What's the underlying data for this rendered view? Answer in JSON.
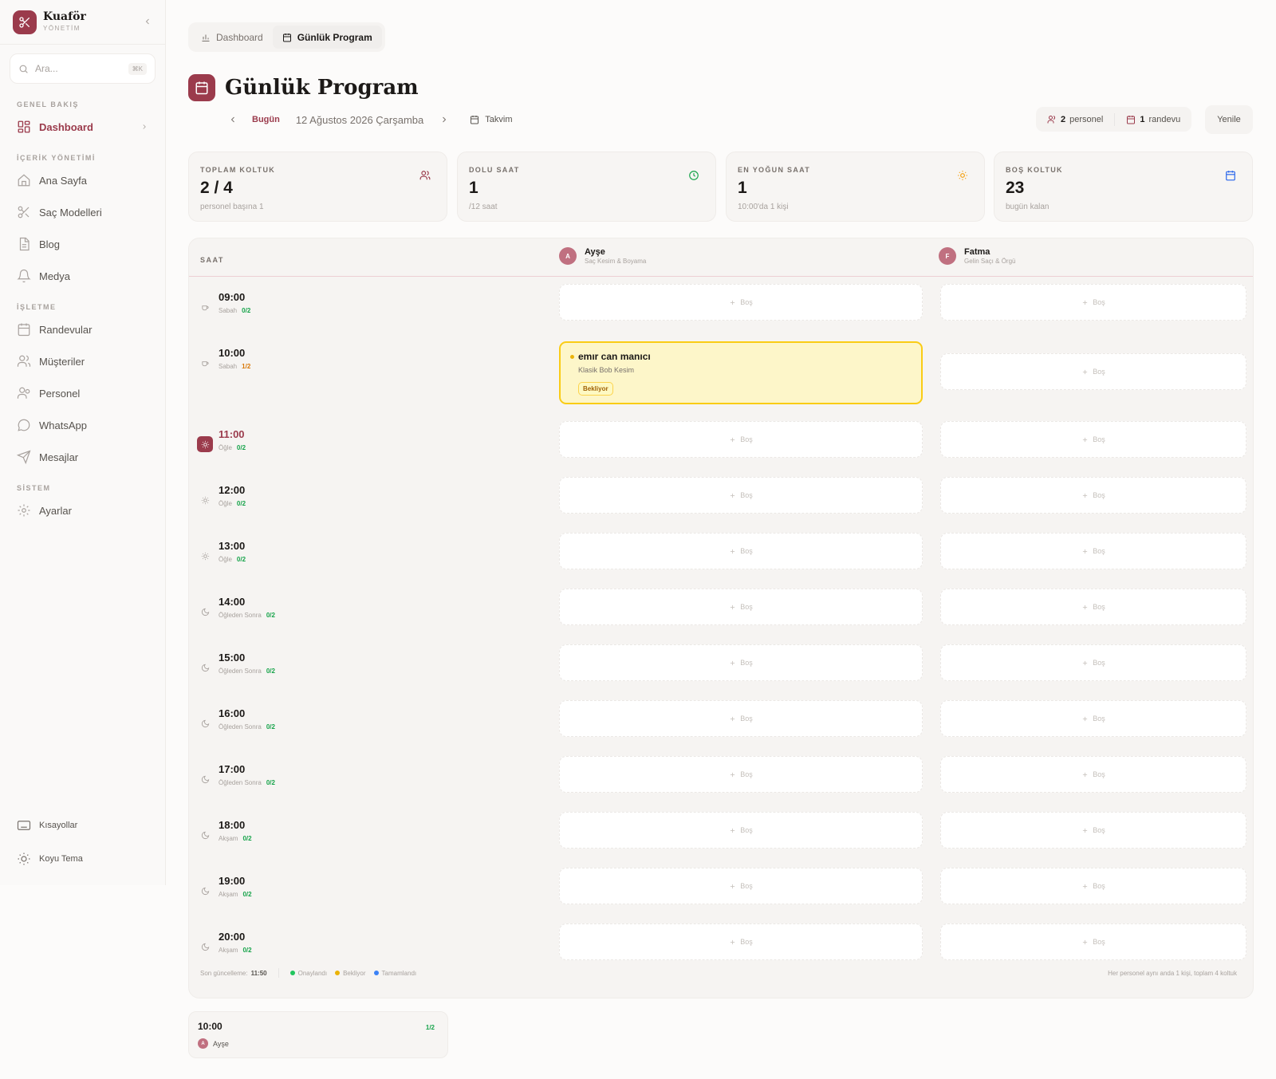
{
  "brand": {
    "name": "Kuaför",
    "subtitle": "YÖNETİM"
  },
  "search": {
    "placeholder": "Ara...",
    "shortcut": "⌘K"
  },
  "sidebar": {
    "groups": [
      {
        "title": "GENEL BAKIŞ",
        "items": [
          {
            "label": "Dashboard",
            "icon": "dashboard-icon",
            "active": true
          }
        ]
      },
      {
        "title": "İÇERİK YÖNETİMİ",
        "items": [
          {
            "label": "Ana Sayfa",
            "icon": "home-icon"
          },
          {
            "label": "Saç Modelleri",
            "icon": "scissors-icon"
          },
          {
            "label": "Blog",
            "icon": "document-icon"
          },
          {
            "label": "Medya",
            "icon": "bell-icon"
          }
        ]
      },
      {
        "title": "İŞLETME",
        "items": [
          {
            "label": "Randevular",
            "icon": "calendar-icon"
          },
          {
            "label": "Müşteriler",
            "icon": "users-icon"
          },
          {
            "label": "Personel",
            "icon": "user-group-icon"
          },
          {
            "label": "WhatsApp",
            "icon": "chat-icon"
          },
          {
            "label": "Mesajlar",
            "icon": "send-icon"
          }
        ]
      },
      {
        "title": "SİSTEM",
        "items": [
          {
            "label": "Ayarlar",
            "icon": "gear-icon"
          }
        ]
      }
    ],
    "bottom": [
      {
        "label": "Kısayollar",
        "icon": "keyboard-icon"
      },
      {
        "label": "Koyu Tema",
        "icon": "sun-icon"
      }
    ]
  },
  "tabs": [
    {
      "label": "Dashboard",
      "icon": "bar-chart-icon",
      "active": false
    },
    {
      "label": "Günlük Program",
      "icon": "calendar-icon",
      "active": true
    }
  ],
  "page": {
    "title": "Günlük Program"
  },
  "date_nav": {
    "today_label": "Bugün",
    "date": "12 Ağustos 2026 Çarşamba",
    "calendar_label": "Takvim"
  },
  "summary": {
    "staff_count": "2",
    "staff_label": "personel",
    "appt_count": "1",
    "appt_label": "randevu",
    "refresh_label": "Yenile"
  },
  "stats": [
    {
      "label": "TOPLAM KOLTUK",
      "value": "2 / 4",
      "sub": "personel başına 1",
      "icon": "users-icon",
      "color": "#9b3b4c"
    },
    {
      "label": "DOLU SAAT",
      "value": "1",
      "sub": "/12 saat",
      "icon": "clock-icon",
      "color": "#16a34a"
    },
    {
      "label": "EN YOĞUN SAAT",
      "value": "1",
      "sub": "10:00'da 1 kişi",
      "icon": "sun-icon",
      "color": "#f59e0b"
    },
    {
      "label": "BOŞ KOLTUK",
      "value": "23",
      "sub": "bugün kalan",
      "icon": "calendar-icon",
      "color": "#2563eb"
    }
  ],
  "schedule": {
    "time_header": "SAAT",
    "empty_label": "Boş",
    "staff": [
      {
        "initial": "A",
        "name": "Ayşe",
        "role": "Saç Kesim & Boyama"
      },
      {
        "initial": "F",
        "name": "Fatma",
        "role": "Gelin Saçı & Örgü"
      }
    ],
    "rows": [
      {
        "time": "09:00",
        "period": "Sabah",
        "occupancy": "0/2",
        "icon": "coffee-icon"
      },
      {
        "time": "10:00",
        "period": "Sabah",
        "occupancy": "1/2",
        "icon": "coffee-icon"
      },
      {
        "time": "11:00",
        "period": "Öğle",
        "occupancy": "0/2",
        "icon": "sun-icon",
        "current": true
      },
      {
        "time": "12:00",
        "period": "Öğle",
        "occupancy": "0/2",
        "icon": "sun-icon"
      },
      {
        "time": "13:00",
        "period": "Öğle",
        "occupancy": "0/2",
        "icon": "sun-icon"
      },
      {
        "time": "14:00",
        "period": "Öğleden Sonra",
        "occupancy": "0/2",
        "icon": "moon-icon"
      },
      {
        "time": "15:00",
        "period": "Öğleden Sonra",
        "occupancy": "0/2",
        "icon": "moon-icon"
      },
      {
        "time": "16:00",
        "period": "Öğleden Sonra",
        "occupancy": "0/2",
        "icon": "moon-icon"
      },
      {
        "time": "17:00",
        "period": "Öğleden Sonra",
        "occupancy": "0/2",
        "icon": "moon-icon"
      },
      {
        "time": "18:00",
        "period": "Akşam",
        "occupancy": "0/2",
        "icon": "moon-icon"
      },
      {
        "time": "19:00",
        "period": "Akşam",
        "occupancy": "0/2",
        "icon": "moon-icon"
      },
      {
        "time": "20:00",
        "period": "Akşam",
        "occupancy": "0/2",
        "icon": "moon-icon"
      }
    ],
    "appointment": {
      "customer": "emır can manıcı",
      "service": "Klasik Bob Kesim",
      "status": "Bekliyor",
      "time": "10:00",
      "staff": "Ayşe"
    },
    "footer": {
      "updated_label": "Son güncelleme:",
      "updated_time": "11:50",
      "legend": [
        {
          "label": "Onaylandı",
          "color": "#22c55e"
        },
        {
          "label": "Bekliyor",
          "color": "#eab308"
        },
        {
          "label": "Tamamlandı",
          "color": "#3b82f6"
        }
      ],
      "note": "Her personel aynı anda 1 kişi, toplam 4 koltuk"
    }
  },
  "mini_card": {
    "time": "10:00",
    "occupancy": "1/2",
    "staff_initial": "A",
    "staff_name": "Ayşe"
  }
}
